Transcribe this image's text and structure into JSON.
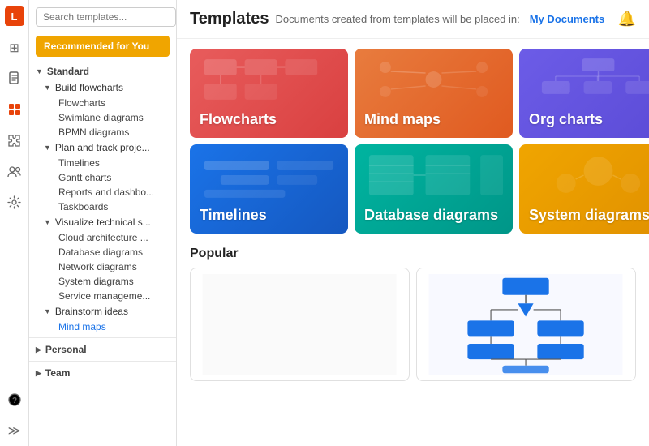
{
  "header": {
    "title": "Templates",
    "subtitle": "Documents created from templates will be placed in:",
    "location_link": "My Documents",
    "bell_icon": "🔔"
  },
  "search": {
    "placeholder": "Search templates..."
  },
  "sidebar": {
    "recommended_label": "Recommended for You",
    "tree": [
      {
        "id": "standard",
        "label": "Standard",
        "level": 1,
        "type": "section",
        "expanded": true
      },
      {
        "id": "build-flowcharts",
        "label": "Build flowcharts",
        "level": 2,
        "type": "section",
        "expanded": true
      },
      {
        "id": "flowcharts",
        "label": "Flowcharts",
        "level": 3,
        "type": "leaf"
      },
      {
        "id": "swimlane-diagrams",
        "label": "Swimlane diagrams",
        "level": 3,
        "type": "leaf"
      },
      {
        "id": "bpmn-diagrams",
        "label": "BPMN diagrams",
        "level": 3,
        "type": "leaf"
      },
      {
        "id": "plan-track",
        "label": "Plan and track proje...",
        "level": 2,
        "type": "section",
        "expanded": true
      },
      {
        "id": "timelines",
        "label": "Timelines",
        "level": 3,
        "type": "leaf"
      },
      {
        "id": "gantt-charts",
        "label": "Gantt charts",
        "level": 3,
        "type": "leaf"
      },
      {
        "id": "reports-dashboards",
        "label": "Reports and dashbo...",
        "level": 3,
        "type": "leaf"
      },
      {
        "id": "taskboards",
        "label": "Taskboards",
        "level": 3,
        "type": "leaf"
      },
      {
        "id": "visualize-technical",
        "label": "Visualize technical s...",
        "level": 2,
        "type": "section",
        "expanded": true
      },
      {
        "id": "cloud-architecture",
        "label": "Cloud architecture ...",
        "level": 3,
        "type": "leaf"
      },
      {
        "id": "database-diagrams",
        "label": "Database diagrams",
        "level": 3,
        "type": "leaf"
      },
      {
        "id": "network-diagrams",
        "label": "Network diagrams",
        "level": 3,
        "type": "leaf"
      },
      {
        "id": "system-diagrams",
        "label": "System diagrams",
        "level": 3,
        "type": "leaf"
      },
      {
        "id": "service-management",
        "label": "Service manageme...",
        "level": 3,
        "type": "leaf"
      },
      {
        "id": "brainstorm-ideas",
        "label": "Brainstorm ideas",
        "level": 2,
        "type": "section",
        "expanded": true
      },
      {
        "id": "mind-maps",
        "label": "Mind maps",
        "level": 3,
        "type": "leaf"
      }
    ],
    "personal_section": "Personal",
    "team_section": "Team"
  },
  "cards": [
    {
      "id": "flowcharts",
      "label": "Flowcharts",
      "class": "flowcharts"
    },
    {
      "id": "mindmaps",
      "label": "Mind maps",
      "class": "mindmaps"
    },
    {
      "id": "orgcharts",
      "label": "Org charts",
      "class": "orgcharts"
    },
    {
      "id": "timelines",
      "label": "Timelines",
      "class": "timelines"
    },
    {
      "id": "dbdiagrams",
      "label": "Database diagrams",
      "class": "dbdiagrams"
    },
    {
      "id": "sysdiagrams",
      "label": "System diagrams",
      "class": "sysdiagrams"
    }
  ],
  "popular_section_title": "Popular",
  "nav_icons": {
    "logo": "L",
    "grid_icon": "⊞",
    "doc_icon": "📄",
    "template_icon": "🗂",
    "puzzle_icon": "🧩",
    "team_icon": "👥",
    "settings_icon": "⚙",
    "help_icon": "?",
    "collapse_icon": "≫"
  }
}
